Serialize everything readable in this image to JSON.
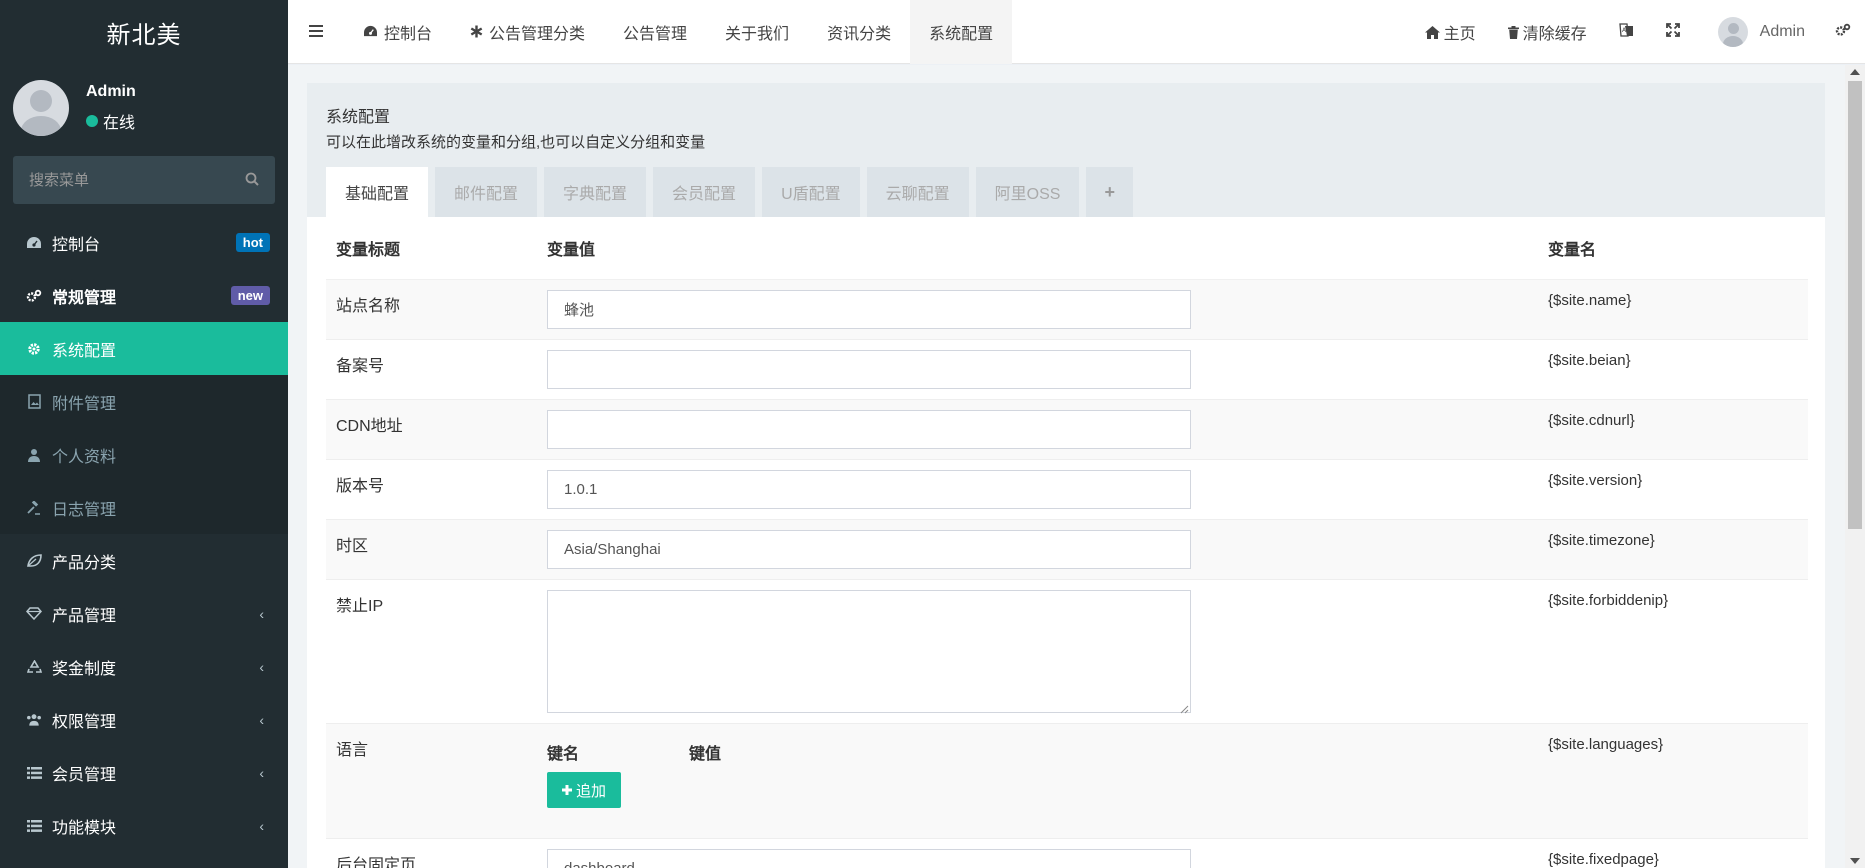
{
  "brand": "新北美",
  "user": {
    "name": "Admin",
    "status": "在线"
  },
  "search": {
    "placeholder": "搜索菜单"
  },
  "menu": [
    {
      "label": "控制台",
      "badge": "hot"
    },
    {
      "label": "常规管理",
      "badge": "new"
    },
    {
      "label": "系统配置"
    },
    {
      "label": "附件管理"
    },
    {
      "label": "个人资料"
    },
    {
      "label": "日志管理"
    },
    {
      "label": "产品分类"
    },
    {
      "label": "产品管理"
    },
    {
      "label": "奖金制度"
    },
    {
      "label": "权限管理"
    },
    {
      "label": "会员管理"
    },
    {
      "label": "功能模块"
    }
  ],
  "navtabs": [
    {
      "label": "控制台"
    },
    {
      "label": "公告管理分类"
    },
    {
      "label": "公告管理"
    },
    {
      "label": "关于我们"
    },
    {
      "label": "资讯分类"
    },
    {
      "label": "系统配置"
    }
  ],
  "navright": {
    "home": "主页",
    "clear_cache": "清除缓存",
    "user": "Admin"
  },
  "panel": {
    "title": "系统配置",
    "desc": "可以在此增改系统的变量和分组,也可以自定义分组和变量",
    "tabs": [
      "基础配置",
      "邮件配置",
      "字典配置",
      "会员配置",
      "U盾配置",
      "云聊配置",
      "阿里OSS"
    ],
    "plus": "+"
  },
  "table": {
    "headers": {
      "title": "变量标题",
      "value": "变量值",
      "name": "变量名"
    },
    "rows": [
      {
        "title": "站点名称",
        "value": "蜂池",
        "name": "{$site.name}"
      },
      {
        "title": "备案号",
        "value": "",
        "name": "{$site.beian}"
      },
      {
        "title": "CDN地址",
        "value": "",
        "name": "{$site.cdnurl}"
      },
      {
        "title": "版本号",
        "value": "1.0.1",
        "name": "{$site.version}"
      },
      {
        "title": "时区",
        "value": "Asia/Shanghai",
        "name": "{$site.timezone}"
      },
      {
        "title": "禁止IP",
        "value": "",
        "name": "{$site.forbiddenip}"
      },
      {
        "title": "语言",
        "name": "{$site.languages}",
        "key_label": "键名",
        "val_label": "键值",
        "add_label": "追加"
      },
      {
        "title": "后台固定页",
        "value": "dashboard",
        "name": "{$site.fixedpage}"
      }
    ]
  },
  "colors": {
    "accent": "#1abc9c",
    "sidebar": "#222d32",
    "hot": "#0073b7",
    "new": "#605ca8"
  }
}
